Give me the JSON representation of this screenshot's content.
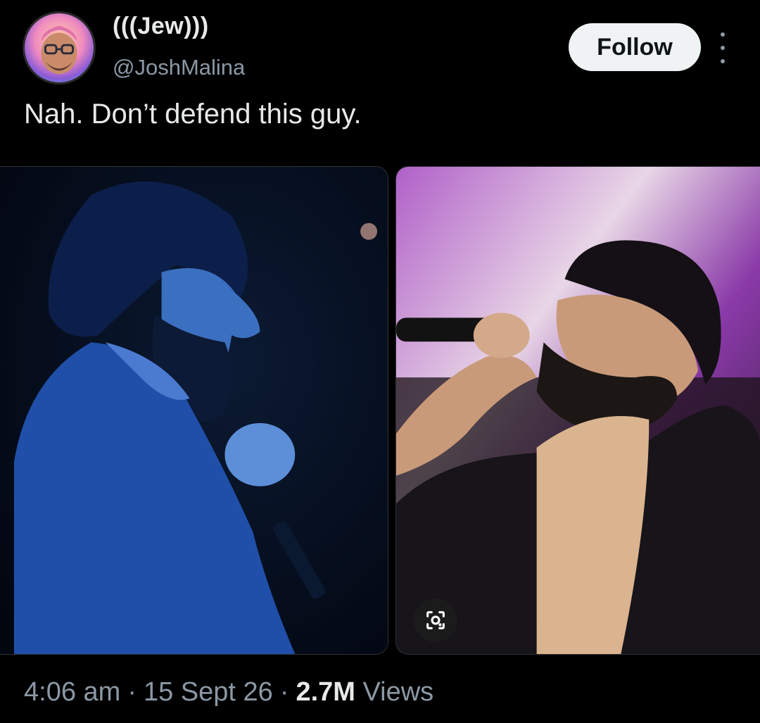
{
  "tweet": {
    "author": {
      "display_name": "(((Jew)))",
      "handle": "@JoshMalina",
      "avatar_icon": "profile-avatar"
    },
    "follow_label": "Follow",
    "more_icon": "more-vertical-icon",
    "text": "Nah. Don’t defend this guy.",
    "media": [
      {
        "name": "performer-blue-stage-photo",
        "tint": "#1f4fa8"
      },
      {
        "name": "performer-microphone-photo",
        "tint": "#2a1a1a"
      }
    ],
    "lens_icon": "google-lens-icon",
    "meta": {
      "time": "4:06 am",
      "date": "15 Sept 26",
      "views_count": "2.7M",
      "views_label": "Views"
    }
  }
}
